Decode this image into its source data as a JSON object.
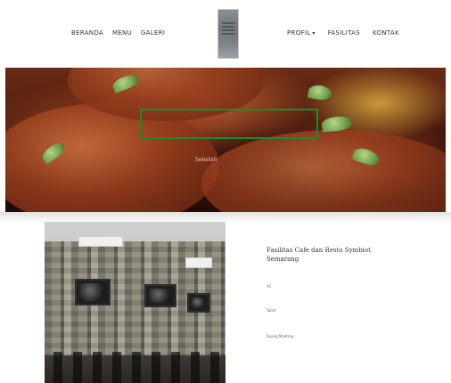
{
  "nav": {
    "left": [
      {
        "label": "BERANDA"
      },
      {
        "label": "MENU"
      },
      {
        "label": "GALERI"
      }
    ],
    "right": [
      {
        "label": "PROFIL",
        "caret": "▾"
      },
      {
        "label": "FASILITAS"
      },
      {
        "label": "KONTAK"
      }
    ]
  },
  "hero": {
    "caption": "Sebelah"
  },
  "facility": {
    "title": "Fasilitas Cafe dan Resto Symbiot Semarang",
    "lines": [
      "AC",
      "Toilet",
      "Ruang Meeting"
    ]
  },
  "colors": {
    "highlight": "#1e8a2a",
    "text": "#333333"
  },
  "icons": {
    "logo": "logo-image"
  }
}
